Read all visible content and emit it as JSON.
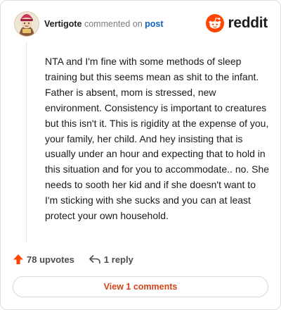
{
  "comment": {
    "author": "Vertigote",
    "action_text": "commented on",
    "post_link": "post",
    "body": "NTA and I'm fine with some methods of sleep training but this seems mean as shit to the infant. Father is absent, mom is stressed, new environment. Consistency is important to creatures but this isn't it. This is rigidity at the expense of you, your family, her child. And hey insisting that is usually under an hour and expecting that to hold in this situation and for you to accommodate.. no. She needs to sooth her kid and if she doesn't want to I'm sticking with she sucks and you can at least protect your own household."
  },
  "brand": {
    "name": "reddit",
    "icon": "reddit-logo-icon",
    "color": "#ff4500"
  },
  "actions": {
    "upvotes": "78 upvotes",
    "upvote_icon": "upvote-arrow-icon",
    "replies": "1 reply",
    "reply_icon": "reply-arrow-icon"
  },
  "footer": {
    "view_comments": "View 1 comments"
  },
  "colors": {
    "accent": "#d1451e",
    "upvote": "#ff4500",
    "link": "#0b62c4"
  }
}
